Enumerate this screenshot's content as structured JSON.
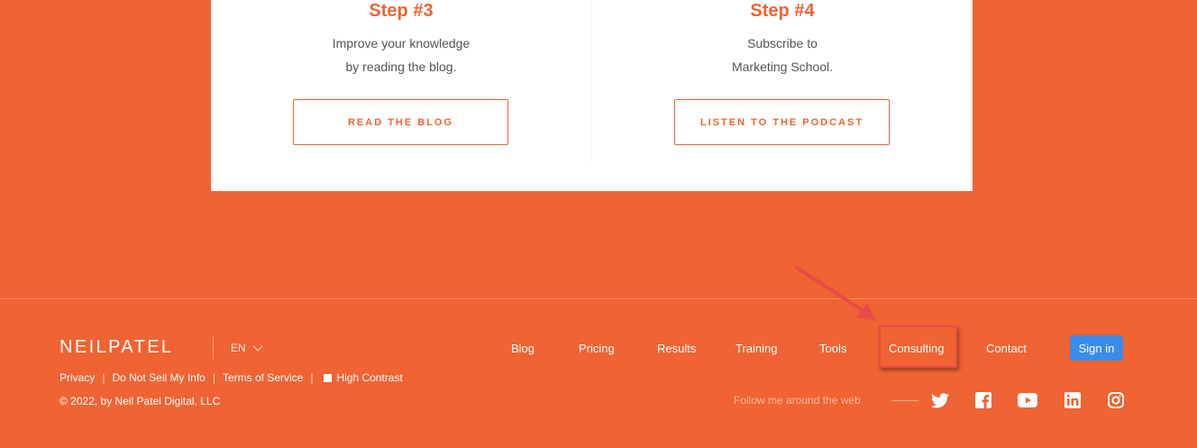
{
  "steps": [
    {
      "title": "Step #3",
      "line1": "Improve your knowledge",
      "line2": "by reading the blog.",
      "button": "READ THE BLOG"
    },
    {
      "title": "Step #4",
      "line1": "Subscribe to",
      "line2": "Marketing School.",
      "button": "LISTEN TO THE PODCAST"
    }
  ],
  "footer": {
    "logo": "NEILPATEL",
    "language": "EN",
    "legal": {
      "privacy": "Privacy",
      "do_not_sell": "Do Not Sell My Info",
      "terms": "Terms of Service",
      "high_contrast": "High Contrast",
      "separator": "|"
    },
    "copyright": "© 2022, by Neil Patel Digital, LLC",
    "nav": {
      "blog": "Blog",
      "pricing": "Pricing",
      "results": "Results",
      "training": "Training",
      "tools": "Tools",
      "consulting": "Consulting",
      "contact": "Contact"
    },
    "signin": "Sign in",
    "follow": "Follow me around the web",
    "social_icons": [
      "twitter-icon",
      "facebook-icon",
      "youtube-icon",
      "linkedin-icon",
      "instagram-icon"
    ]
  },
  "colors": {
    "background": "#f06332",
    "card": "#ffffff",
    "signin": "#3b8bea",
    "highlight": "#e94a4a"
  }
}
